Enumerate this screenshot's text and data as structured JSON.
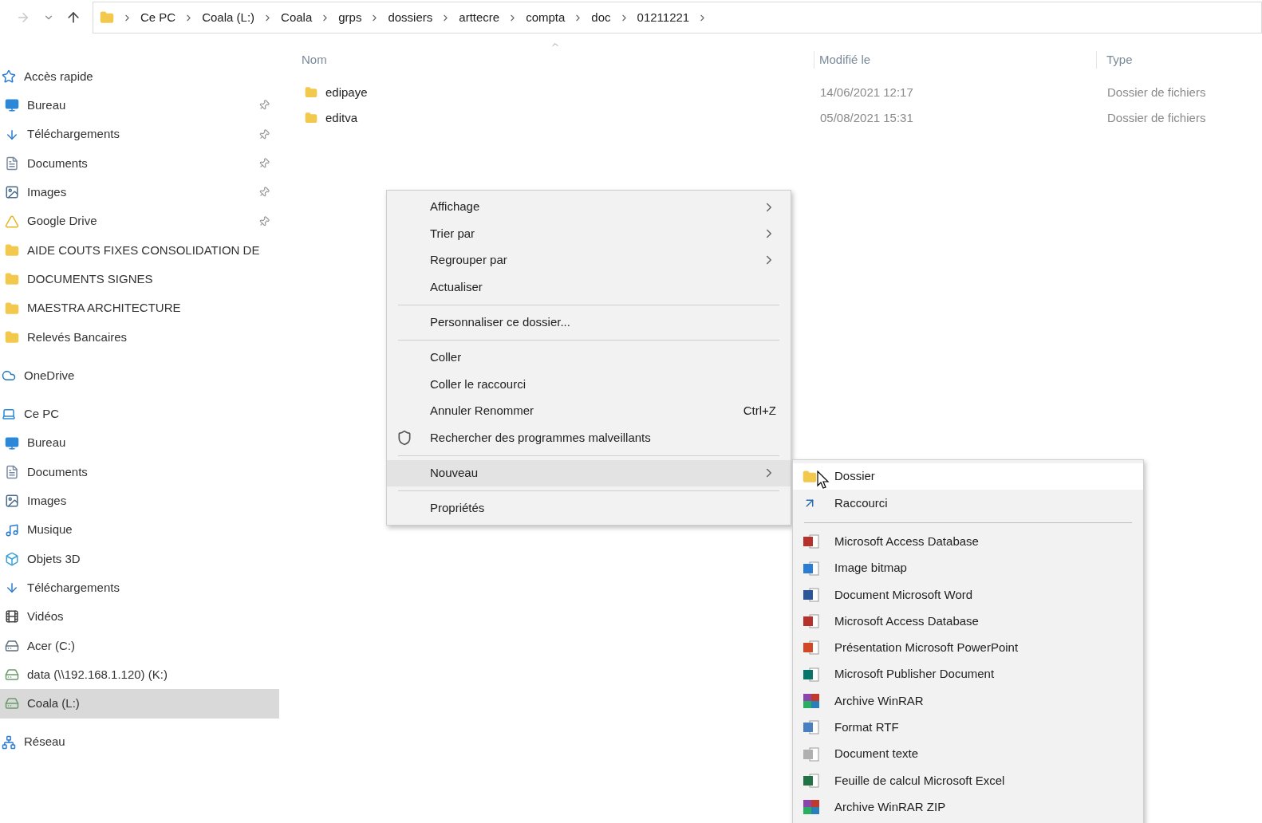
{
  "address_bar": {
    "path": [
      "Ce PC",
      "Coala (L:)",
      "Coala",
      "grps",
      "dossiers",
      "arttecre",
      "compta",
      "doc",
      "01211221"
    ]
  },
  "sidebar": {
    "items": [
      {
        "label": "Accès rapide",
        "kind": "star",
        "section": true,
        "pinned": false,
        "selected": false
      },
      {
        "label": "Bureau",
        "kind": "desktop",
        "section": false,
        "pinned": true,
        "selected": false
      },
      {
        "label": "Téléchargements",
        "kind": "download",
        "section": false,
        "pinned": true,
        "selected": false
      },
      {
        "label": "Documents",
        "kind": "document",
        "section": false,
        "pinned": true,
        "selected": false
      },
      {
        "label": "Images",
        "kind": "image",
        "section": false,
        "pinned": true,
        "selected": false
      },
      {
        "label": "Google Drive",
        "kind": "gdrive",
        "section": false,
        "pinned": true,
        "selected": false
      },
      {
        "label": "AIDE COUTS FIXES CONSOLIDATION DE",
        "kind": "folder",
        "section": false,
        "pinned": false,
        "selected": false
      },
      {
        "label": "DOCUMENTS SIGNES",
        "kind": "folder",
        "section": false,
        "pinned": false,
        "selected": false
      },
      {
        "label": "MAESTRA ARCHITECTURE",
        "kind": "folder",
        "section": false,
        "pinned": false,
        "selected": false
      },
      {
        "label": "Relevés Bancaires",
        "kind": "folder",
        "section": false,
        "pinned": false,
        "selected": false
      },
      {
        "label": "OneDrive",
        "kind": "cloud",
        "section": true,
        "pinned": false,
        "selected": false
      },
      {
        "label": "Ce PC",
        "kind": "pc",
        "section": true,
        "pinned": false,
        "selected": false
      },
      {
        "label": "Bureau",
        "kind": "desktop",
        "section": false,
        "pinned": false,
        "selected": false
      },
      {
        "label": "Documents",
        "kind": "document",
        "section": false,
        "pinned": false,
        "selected": false
      },
      {
        "label": "Images",
        "kind": "image",
        "section": false,
        "pinned": false,
        "selected": false
      },
      {
        "label": "Musique",
        "kind": "music",
        "section": false,
        "pinned": false,
        "selected": false
      },
      {
        "label": "Objets 3D",
        "kind": "cube",
        "section": false,
        "pinned": false,
        "selected": false
      },
      {
        "label": "Téléchargements",
        "kind": "download",
        "section": false,
        "pinned": false,
        "selected": false
      },
      {
        "label": "Vidéos",
        "kind": "video",
        "section": false,
        "pinned": false,
        "selected": false
      },
      {
        "label": "Acer (C:)",
        "kind": "disk",
        "section": false,
        "pinned": false,
        "selected": false
      },
      {
        "label": "data (\\\\192.168.1.120) (K:)",
        "kind": "netdrive",
        "section": false,
        "pinned": false,
        "selected": false
      },
      {
        "label": "Coala (L:)",
        "kind": "netdrive",
        "section": false,
        "pinned": false,
        "selected": true
      },
      {
        "label": "Réseau",
        "kind": "network",
        "section": true,
        "pinned": false,
        "selected": false
      }
    ]
  },
  "file_list": {
    "columns": [
      "Nom",
      "Modifié le",
      "Type"
    ],
    "rows": [
      {
        "name": "edipaye",
        "modified": "14/06/2021 12:17",
        "type": "Dossier de fichiers"
      },
      {
        "name": "editva",
        "modified": "05/08/2021 15:31",
        "type": "Dossier de fichiers"
      }
    ]
  },
  "context_menu": {
    "items": [
      {
        "kind": "item",
        "label": "Affichage",
        "submenu": true,
        "selected": false
      },
      {
        "kind": "item",
        "label": "Trier par",
        "submenu": true,
        "selected": false
      },
      {
        "kind": "item",
        "label": "Regrouper par",
        "submenu": true,
        "selected": false
      },
      {
        "kind": "item",
        "label": "Actualiser",
        "submenu": false,
        "selected": false
      },
      {
        "kind": "separator"
      },
      {
        "kind": "item",
        "label": "Personnaliser ce dossier...",
        "submenu": false,
        "selected": false
      },
      {
        "kind": "separator"
      },
      {
        "kind": "item",
        "label": "Coller",
        "submenu": false,
        "selected": false
      },
      {
        "kind": "item",
        "label": "Coller le raccourci",
        "submenu": false,
        "selected": false
      },
      {
        "kind": "item",
        "label": "Annuler Renommer",
        "shortcut": "Ctrl+Z",
        "submenu": false,
        "selected": false
      },
      {
        "kind": "shield",
        "label": "Rechercher des programmes malveillants",
        "submenu": false,
        "selected": false
      },
      {
        "kind": "separator"
      },
      {
        "kind": "item",
        "label": "Nouveau",
        "submenu": true,
        "selected": true
      },
      {
        "kind": "separator"
      },
      {
        "kind": "item",
        "label": "Propriétés",
        "submenu": false,
        "selected": false
      }
    ]
  },
  "submenu": {
    "items": [
      {
        "kind": "folder",
        "label": "Dossier",
        "selected": true
      },
      {
        "kind": "shortcut",
        "label": "Raccourci",
        "selected": false
      },
      {
        "kind": "separator"
      },
      {
        "kind": "access",
        "label": "Microsoft Access Database",
        "selected": false
      },
      {
        "kind": "bitmap",
        "label": "Image bitmap",
        "selected": false
      },
      {
        "kind": "word",
        "label": "Document Microsoft Word",
        "selected": false
      },
      {
        "kind": "access",
        "label": "Microsoft Access Database",
        "selected": false
      },
      {
        "kind": "powerpoint",
        "label": "Présentation Microsoft PowerPoint",
        "selected": false
      },
      {
        "kind": "publisher",
        "label": "Microsoft Publisher Document",
        "selected": false
      },
      {
        "kind": "winrar",
        "label": "Archive WinRAR",
        "selected": false
      },
      {
        "kind": "rtf",
        "label": "Format RTF",
        "selected": false
      },
      {
        "kind": "text",
        "label": "Document texte",
        "selected": false
      },
      {
        "kind": "excel",
        "label": "Feuille de calcul Microsoft Excel",
        "selected": false
      },
      {
        "kind": "winrar",
        "label": "Archive WinRAR ZIP",
        "selected": false
      }
    ]
  }
}
